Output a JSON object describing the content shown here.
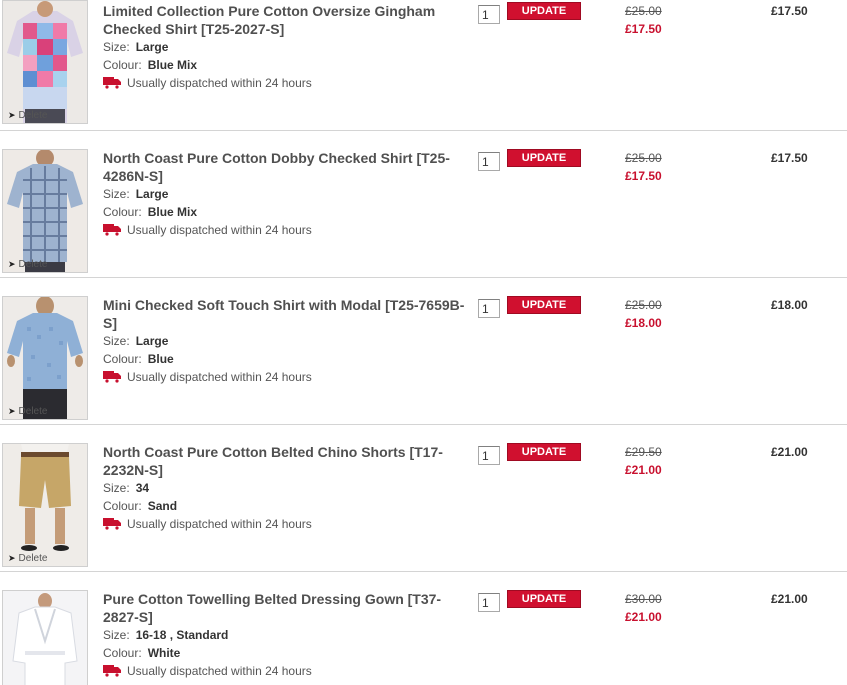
{
  "basket": {
    "delete_label": "Delete",
    "update_label": "UPDATE",
    "size_label": "Size:",
    "colour_label": "Colour:",
    "items": [
      {
        "title": "Limited Collection Pure Cotton Oversize Gingham Checked Shirt [T25-2027-S]",
        "size": "Large",
        "colour": "Blue Mix",
        "dispatch": "Usually dispatched within 24 hours",
        "qty": "1",
        "was_price": "£25.00",
        "now_price": "£17.50",
        "total": "£17.50",
        "image": "gingham-shirt-image"
      },
      {
        "title": "North Coast Pure Cotton Dobby Checked Shirt [T25-4286N-S]",
        "size": "Large",
        "colour": "Blue Mix",
        "dispatch": "Usually dispatched within 24 hours",
        "qty": "1",
        "was_price": "£25.00",
        "now_price": "£17.50",
        "total": "£17.50",
        "image": "checked-shirt-image"
      },
      {
        "title": "Mini Checked Soft Touch Shirt with Modal [T25-7659B-S]",
        "size": "Large",
        "colour": "Blue",
        "dispatch": "Usually dispatched within 24 hours",
        "qty": "1",
        "was_price": "£25.00",
        "now_price": "£18.00",
        "total": "£18.00",
        "image": "blue-shirt-image"
      },
      {
        "title": "North Coast Pure Cotton Belted Chino Shorts [T17-2232N-S]",
        "size": "34",
        "colour": "Sand",
        "dispatch": "Usually dispatched within 24 hours",
        "qty": "1",
        "was_price": "£29.50",
        "now_price": "£21.00",
        "total": "£21.00",
        "image": "chino-shorts-image"
      },
      {
        "title": "Pure Cotton Towelling Belted Dressing Gown [T37-2827-S]",
        "size": "16-18 , Standard",
        "colour": "White",
        "dispatch": "Usually dispatched within 24 hours",
        "qty": "1",
        "was_price": "£30.00",
        "now_price": "£21.00",
        "total": "£21.00",
        "image": "dressing-gown-image"
      }
    ]
  },
  "colors": {
    "accent": "#d0102f",
    "sale_price": "#c8102e",
    "title_text": "#505050",
    "separator": "#d4d4d4"
  }
}
